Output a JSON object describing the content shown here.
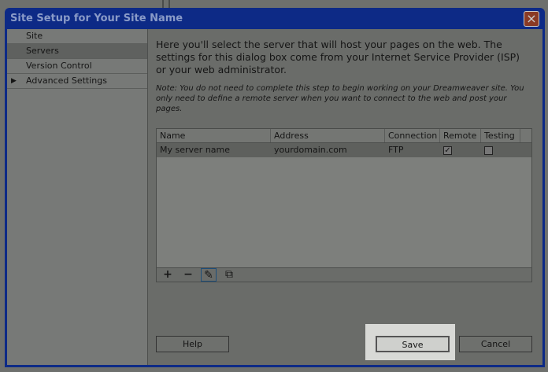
{
  "dialog": {
    "title": "Site Setup for Your Site Name",
    "close_label": "×"
  },
  "sidebar": {
    "items": [
      {
        "label": "Site"
      },
      {
        "label": "Servers"
      },
      {
        "label": "Version Control"
      },
      {
        "label": "Advanced Settings",
        "expander": "▶"
      }
    ]
  },
  "main": {
    "intro": "Here you'll select the server that will host your pages on the web. The settings for this dialog box come from your Internet Service Provider (ISP) or your web administrator.",
    "note": "Note: You do not need to complete this step to begin working on your Dreamweaver site. You only need to define a remote server when you want to connect to the web and post your pages."
  },
  "table": {
    "headers": [
      "Name",
      "Address",
      "Connection",
      "Remote",
      "Testing"
    ],
    "rows": [
      {
        "name": "My server name",
        "address": "yourdomain.com",
        "connection": "FTP",
        "remote": "✓",
        "testing": ""
      }
    ]
  },
  "toolbar": {
    "add": "+",
    "remove": "−",
    "edit": "✎",
    "duplicate": "⧉"
  },
  "buttons": {
    "help": "Help",
    "save": "Save",
    "cancel": "Cancel"
  }
}
